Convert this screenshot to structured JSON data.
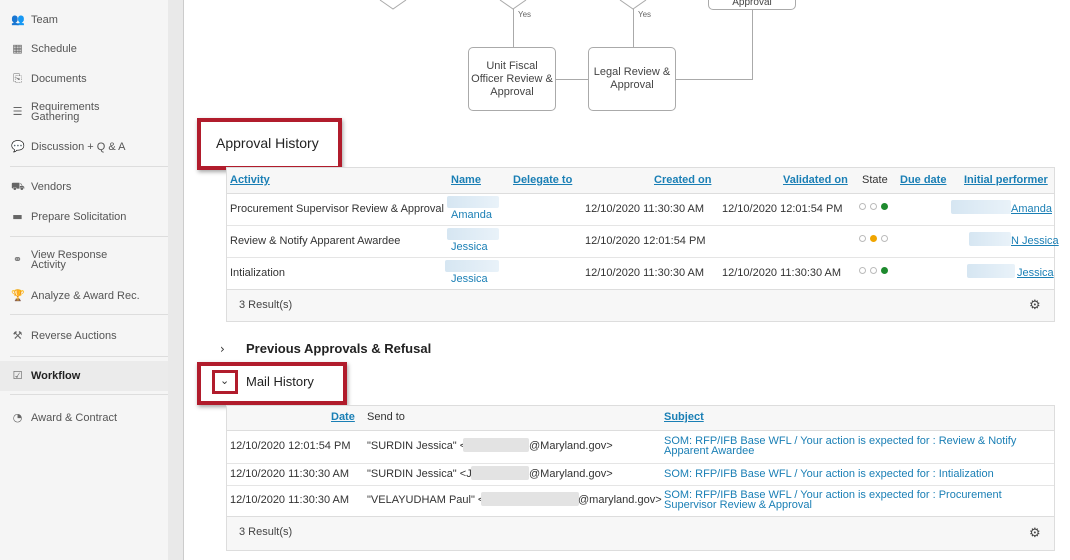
{
  "sidebar": {
    "items": [
      {
        "label": "Team",
        "icon": "team-icon",
        "glyph": "👥"
      },
      {
        "label": "Schedule",
        "icon": "calendar-icon",
        "glyph": "▦"
      },
      {
        "label": "Documents",
        "icon": "document-icon",
        "glyph": "⎘"
      },
      {
        "label": "Requirements Gathering",
        "icon": "list-icon",
        "glyph": "☰"
      },
      {
        "label": "Discussion + Q & A",
        "icon": "chat-icon",
        "glyph": "💬"
      },
      {
        "label": "Vendors",
        "icon": "truck-icon",
        "glyph": "⛟"
      },
      {
        "label": "Prepare Solicitation",
        "icon": "folder-icon",
        "glyph": "▬"
      },
      {
        "label": "View Response Activity",
        "icon": "binoculars-icon",
        "glyph": "⚭"
      },
      {
        "label": "Analyze & Award Rec.",
        "icon": "trophy-icon",
        "glyph": "🏆"
      },
      {
        "label": "Reverse Auctions",
        "icon": "gavel-icon",
        "glyph": "⚒"
      },
      {
        "label": "Workflow",
        "icon": "checkbox-icon",
        "glyph": "☑"
      },
      {
        "label": "Award & Contract",
        "icon": "dashboard-icon",
        "glyph": "◔"
      }
    ]
  },
  "flowchart": {
    "top_box_label": "Approval",
    "box1": "Unit Fiscal Officer Review & Approval",
    "box2": "Legal Review & Approval",
    "yes1": "Yes",
    "yes2": "Yes"
  },
  "approval_history": {
    "title": "Approval History",
    "columns": {
      "activity": "Activity",
      "name": "Name",
      "delegate": "Delegate to",
      "created": "Created on",
      "validated": "Validated on",
      "state": "State",
      "due": "Due date",
      "performer": "Initial performer"
    },
    "rows": [
      {
        "activity": "Procurement Supervisor Review & Approval",
        "name": "Amanda",
        "created": "12/10/2020 11:30:30 AM",
        "validated": "12/10/2020 12:01:54 PM",
        "performer": "Amanda",
        "state": "green"
      },
      {
        "activity": "Review & Notify Apparent Awardee",
        "name": "Jessica",
        "created": "12/10/2020 12:01:54 PM",
        "validated": "",
        "performer": "N Jessica",
        "state": "orange"
      },
      {
        "activity": "Intialization",
        "name": "Jessica",
        "created": "12/10/2020 11:30:30 AM",
        "validated": "12/10/2020 11:30:30 AM",
        "performer": "Jessica",
        "state": "green"
      }
    ],
    "results": "3 Result(s)"
  },
  "previous": {
    "title": "Previous Approvals & Refusal"
  },
  "mail_history": {
    "title": "Mail History",
    "columns": {
      "date": "Date",
      "sendto": "Send to",
      "subject": "Subject"
    },
    "rows": [
      {
        "date": "12/10/2020 12:01:54 PM",
        "to_name": "\"SURDIN Jessica\" <",
        "to_domain": "@Maryland.gov>",
        "subject": "SOM: RFP/IFB Base WFL / Your action is expected for : Review & Notify Apparent Awardee"
      },
      {
        "date": "12/10/2020 11:30:30 AM",
        "to_name": "\"SURDIN Jessica\" <J",
        "to_domain": "@Maryland.gov>",
        "subject": "SOM: RFP/IFB Base WFL / Your action is expected for : Intialization"
      },
      {
        "date": "12/10/2020 11:30:30 AM",
        "to_name": "\"VELAYUDHAM Paul\" <",
        "to_domain": "@maryland.gov>",
        "subject": "SOM: RFP/IFB Base WFL / Your action is expected for : Procurement Supervisor Review & Approval"
      }
    ],
    "results": "3 Result(s)"
  },
  "colors": {
    "link": "#1a7fb5",
    "highlight": "#b11c2c",
    "ok": "#1e8a2e",
    "pending": "#f0a500"
  }
}
